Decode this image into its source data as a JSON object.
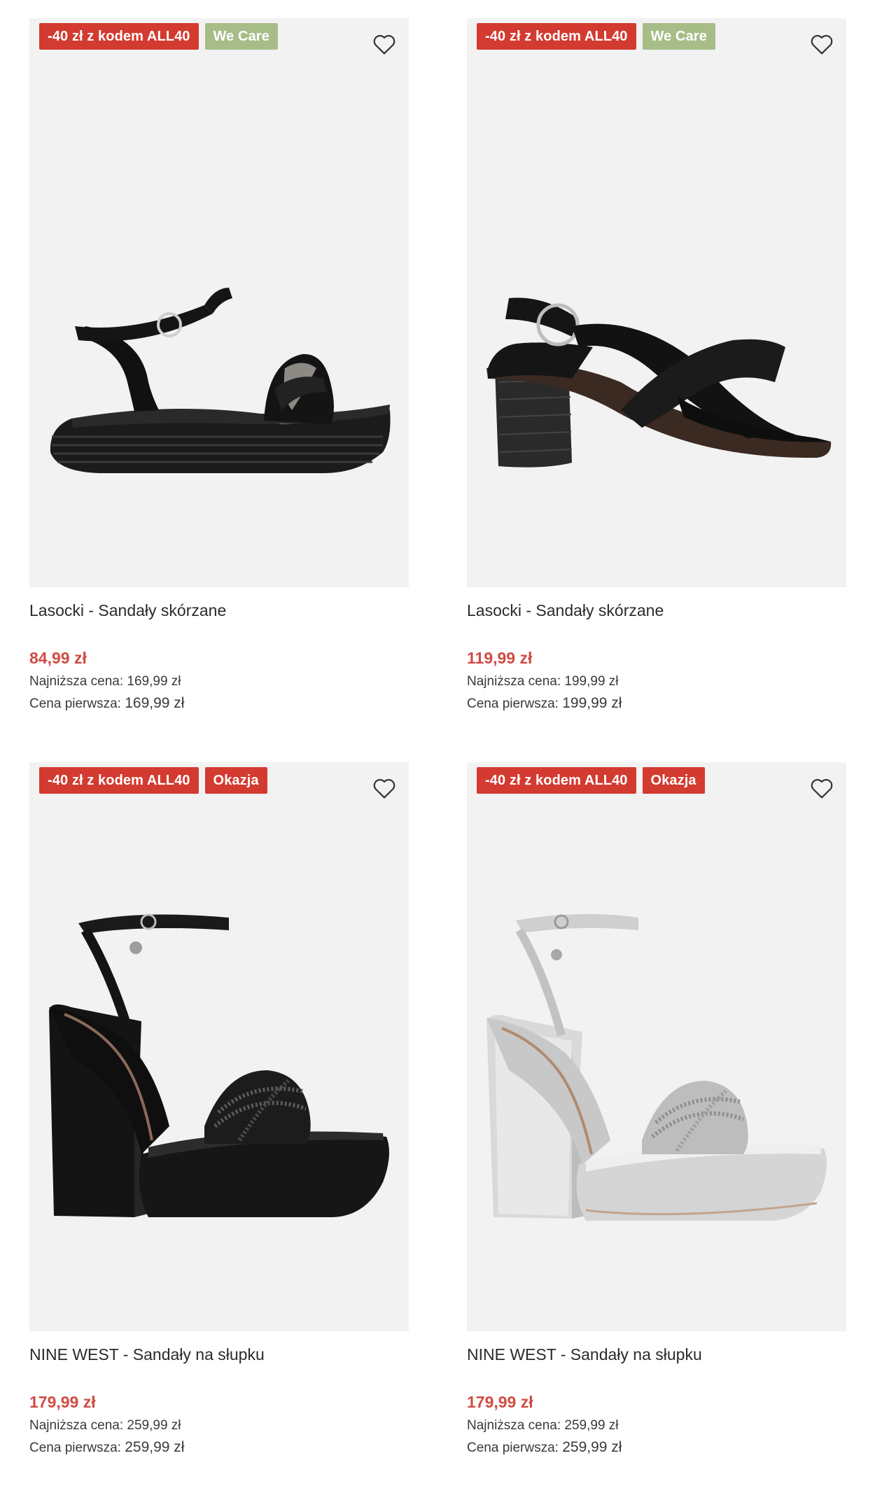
{
  "products": [
    {
      "badges": [
        "-40 zł z kodem ALL40",
        "We Care"
      ],
      "name": "Lasocki - Sandały skórzane",
      "price": "84,99 zł",
      "lowest_label": "Najniższa cena:",
      "lowest_value": "169,99 zł",
      "first_label": "Cena pierwsza:",
      "first_value": "169,99 zł"
    },
    {
      "badges": [
        "-40 zł z kodem ALL40",
        "We Care"
      ],
      "name": "Lasocki - Sandały skórzane",
      "price": "119,99 zł",
      "lowest_label": "Najniższa cena:",
      "lowest_value": "199,99 zł",
      "first_label": "Cena pierwsza:",
      "first_value": "199,99 zł"
    },
    {
      "badges": [
        "-40 zł z kodem ALL40",
        "Okazja"
      ],
      "name": "NINE WEST - Sandały na słupku",
      "price": "179,99 zł",
      "lowest_label": "Najniższa cena:",
      "lowest_value": "259,99 zł",
      "first_label": "Cena pierwsza:",
      "first_value": "259,99 zł"
    },
    {
      "badges": [
        "-40 zł z kodem ALL40",
        "Okazja"
      ],
      "name": "NINE WEST - Sandały na słupku",
      "price": "179,99 zł",
      "lowest_label": "Najniższa cena:",
      "lowest_value": "259,99 zł",
      "first_label": "Cena pierwsza:",
      "first_value": "259,99 zł"
    }
  ],
  "icons": {
    "wishlist": "heart-icon"
  },
  "colors": {
    "promo_badge": "#d33a30",
    "care_badge": "#a7bd88",
    "price": "#d04c44",
    "image_bg": "#f2f2f2"
  }
}
